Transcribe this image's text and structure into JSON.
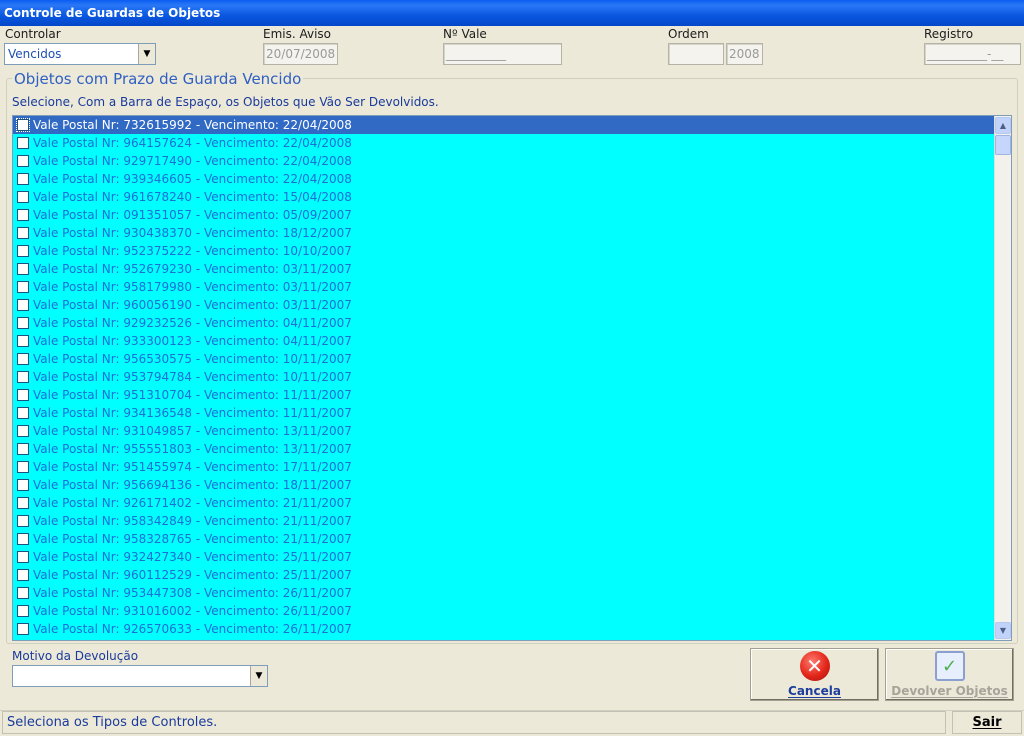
{
  "window": {
    "title": "Controle de Guardas de Objetos"
  },
  "header": {
    "controlar_label": "Controlar",
    "controlar_value": "Vencidos",
    "emis_aviso_label": "Emis. Aviso",
    "emis_aviso_value": "20/07/2008",
    "n_vale_label": "Nº Vale",
    "n_vale_value": "__________",
    "ordem_label": "Ordem",
    "ordem_value": "",
    "ordem_year": "2008",
    "registro_label": "Registro",
    "registro_value": "__________-__"
  },
  "group": {
    "title": "Objetos com Prazo de Guarda Vencido",
    "instruction": "Selecione, Com a Barra de Espaço, os Objetos que Vão Ser Devolvidos."
  },
  "list_items": [
    "Vale Postal Nr: 732615992 - Vencimento: 22/04/2008",
    "Vale Postal Nr: 964157624 - Vencimento: 22/04/2008",
    "Vale Postal Nr: 929717490 - Vencimento: 22/04/2008",
    "Vale Postal Nr: 939346605 - Vencimento: 22/04/2008",
    "Vale Postal Nr: 961678240 - Vencimento: 15/04/2008",
    "Vale Postal Nr: 091351057 - Vencimento: 05/09/2007",
    "Vale Postal Nr: 930438370 - Vencimento: 18/12/2007",
    "Vale Postal Nr: 952375222 - Vencimento: 10/10/2007",
    "Vale Postal Nr: 952679230 - Vencimento: 03/11/2007",
    "Vale Postal Nr: 958179980 - Vencimento: 03/11/2007",
    "Vale Postal Nr: 960056190 - Vencimento: 03/11/2007",
    "Vale Postal Nr: 929232526 - Vencimento: 04/11/2007",
    "Vale Postal Nr: 933300123 - Vencimento: 04/11/2007",
    "Vale Postal Nr: 956530575 - Vencimento: 10/11/2007",
    "Vale Postal Nr: 953794784 - Vencimento: 10/11/2007",
    "Vale Postal Nr: 951310704 - Vencimento: 11/11/2007",
    "Vale Postal Nr: 934136548 - Vencimento: 11/11/2007",
    "Vale Postal Nr: 931049857 - Vencimento: 13/11/2007",
    "Vale Postal Nr: 955551803 - Vencimento: 13/11/2007",
    "Vale Postal Nr: 951455974 - Vencimento: 17/11/2007",
    "Vale Postal Nr: 956694136 - Vencimento: 18/11/2007",
    "Vale Postal Nr: 926171402 - Vencimento: 21/11/2007",
    "Vale Postal Nr: 958342849 - Vencimento: 21/11/2007",
    "Vale Postal Nr: 958328765 - Vencimento: 21/11/2007",
    "Vale Postal Nr: 932427340 - Vencimento: 25/11/2007",
    "Vale Postal Nr: 960112529 - Vencimento: 25/11/2007",
    "Vale Postal Nr: 953447308 - Vencimento: 26/11/2007",
    "Vale Postal Nr: 931016002 - Vencimento: 26/11/2007",
    "Vale Postal Nr: 926570633 - Vencimento: 26/11/2007"
  ],
  "footer": {
    "motivo_label": "Motivo da Devolução",
    "motivo_value": "",
    "cancel_label": "Cancela",
    "return_label": "Devolver Objetos"
  },
  "status": {
    "text": "Seleciona os Tipos de Controles.",
    "exit_label": "Sair"
  },
  "icons": {
    "combo_arrow": "chevron-down-icon",
    "cancel": "cancel-x-icon",
    "return": "return-check-icon"
  },
  "colors": {
    "list_bg": "#00ffff",
    "selected_row": "#316ac5",
    "title_bar": "#0a5cf0",
    "label_blue": "#1c4fb0"
  }
}
